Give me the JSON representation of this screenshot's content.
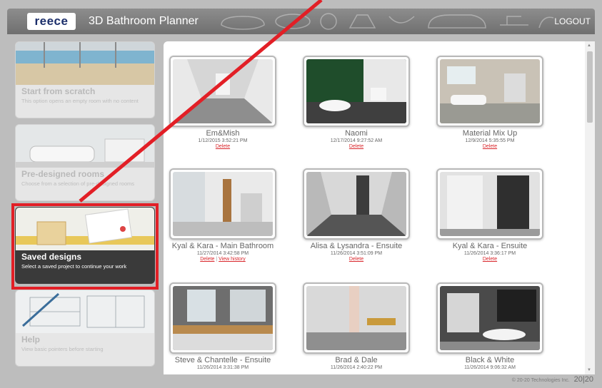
{
  "header": {
    "logo_text": "reece",
    "app_title": "3D Bathroom Planner",
    "logout_label": "LOGOUT"
  },
  "sidebar": {
    "items": [
      {
        "title": "Start from scratch",
        "description": "This option opens an empty room with no content"
      },
      {
        "title": "Pre-designed rooms",
        "description": "Choose from a selection of pre-designed rooms"
      },
      {
        "title": "Saved designs",
        "description": "Select a saved project to continue your work"
      },
      {
        "title": "Help",
        "description": "View basic pointers before starting"
      }
    ]
  },
  "designs": [
    {
      "name": "Em&Mish",
      "date": "1/12/2015 3:52:21 PM",
      "delete_label": "Delete"
    },
    {
      "name": "Naomi",
      "date": "12/17/2014 9:27:52 AM",
      "delete_label": "Delete"
    },
    {
      "name": "Material Mix Up",
      "date": "12/9/2014 5:35:55 PM",
      "delete_label": "Delete"
    },
    {
      "name": "Kyal & Kara - Main Bathroom",
      "date": "11/27/2014 3:42:58 PM",
      "delete_label": "Delete",
      "history_label": "View history"
    },
    {
      "name": "Alisa & Lysandra - Ensuite",
      "date": "11/26/2014 3:51:09 PM",
      "delete_label": "Delete"
    },
    {
      "name": "Kyal & Kara - Ensuite",
      "date": "11/26/2014 3:36:17 PM",
      "delete_label": "Delete"
    },
    {
      "name": "Steve & Chantelle - Ensuite",
      "date": "11/26/2014 3:31:38 PM"
    },
    {
      "name": "Brad & Dale",
      "date": "11/26/2014 2:40:22 PM"
    },
    {
      "name": "Black & White",
      "date": "11/26/2014 9:06:32 AM"
    }
  ],
  "footer": {
    "copyright": "© 20-20 Technologies Inc.",
    "logo": "20|20"
  },
  "colors": {
    "header": "#7e7e7e",
    "accent_red": "#e21f26",
    "active_item": "#3a3a3a"
  }
}
